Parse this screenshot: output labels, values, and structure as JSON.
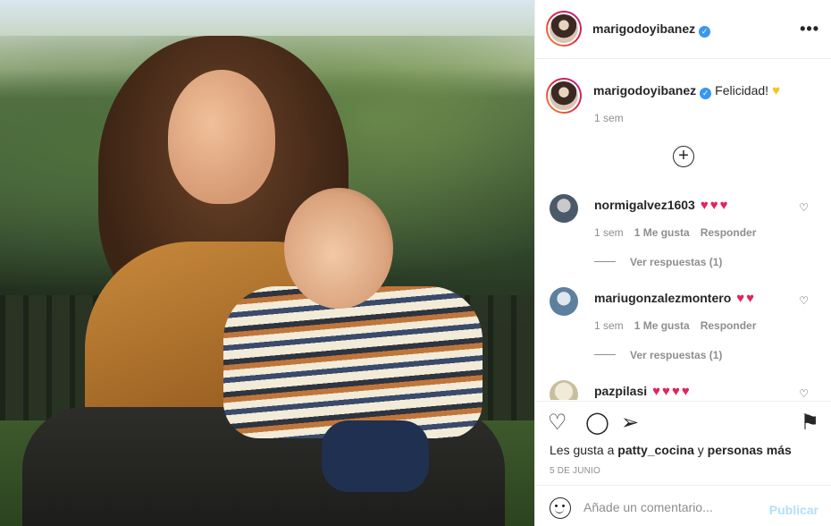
{
  "post": {
    "username": "marigodoyibanez",
    "verified_mark": "✓",
    "more_icon": "•••"
  },
  "caption": {
    "username": "marigodoyibanez",
    "text": "Felicidad!",
    "emoji": "♥",
    "time": "1 sem"
  },
  "load_more_icon": "+",
  "comments": [
    {
      "username": "normigalvez1603",
      "text": "♥♥♥",
      "time": "1 sem",
      "likes": "1 Me gusta",
      "reply": "Responder",
      "replies": "Ver respuestas (1)",
      "like_icon": "♡"
    },
    {
      "username": "mariugonzalezmontero",
      "text": "♥♥",
      "time": "1 sem",
      "likes": "1 Me gusta",
      "reply": "Responder",
      "replies": "Ver respuestas (1)",
      "like_icon": "♡"
    },
    {
      "username": "pazpilasi",
      "text": "♥♥♥♥",
      "like_icon": "♡"
    }
  ],
  "actions": {
    "like_icon": "♡",
    "comment_icon": "◯",
    "share_icon": "➢",
    "save_icon": "⚑",
    "likes_prefix": "Les gusta a",
    "likes_user": "patty_cocina",
    "likes_and": "y",
    "likes_more": "personas más",
    "date": "5 DE JUNIO"
  },
  "composer": {
    "placeholder": "Añade un comentario...",
    "post_label": "Publicar"
  },
  "colors": {
    "link": "#3897f0",
    "muted": "#8e8e8e",
    "post_disabled": "#b2dffc",
    "heart_red": "#e0245e",
    "heart_yellow": "#f5c518"
  }
}
